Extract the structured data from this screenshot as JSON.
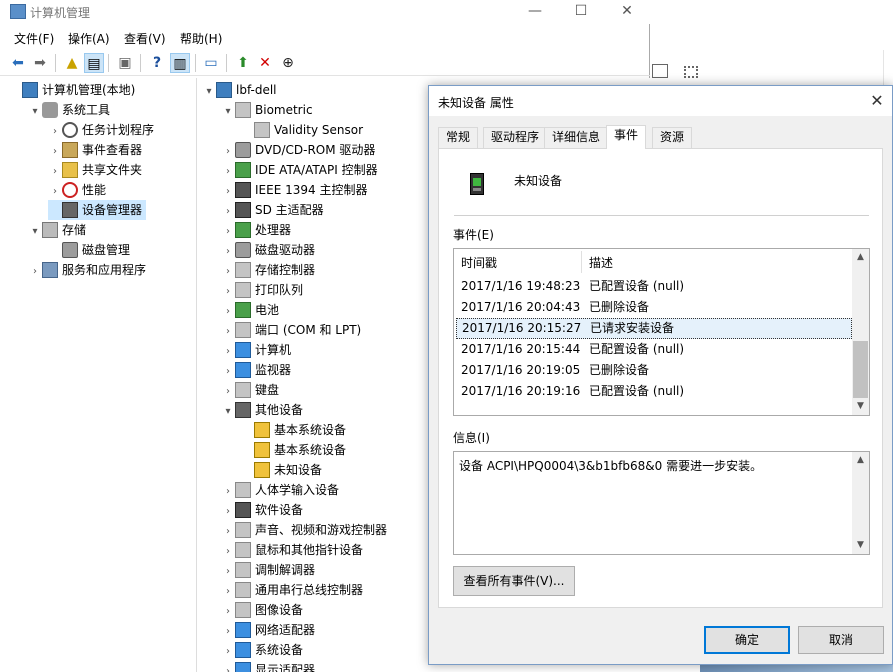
{
  "window": {
    "title": "计算机管理"
  },
  "menu": [
    "文件(F)",
    "操作(A)",
    "查看(V)",
    "帮助(H)"
  ],
  "left_tree": [
    {
      "label": "计算机管理(本地)",
      "indent": 0,
      "arrow": "",
      "icon": "i-pc"
    },
    {
      "label": "系统工具",
      "indent": 1,
      "arrow": "▾",
      "icon": "i-tool"
    },
    {
      "label": "任务计划程序",
      "indent": 2,
      "arrow": "›",
      "icon": "i-clock"
    },
    {
      "label": "事件查看器",
      "indent": 2,
      "arrow": "›",
      "icon": "i-ev"
    },
    {
      "label": "共享文件夹",
      "indent": 2,
      "arrow": "›",
      "icon": "i-share"
    },
    {
      "label": "性能",
      "indent": 2,
      "arrow": "›",
      "icon": "i-perf"
    },
    {
      "label": "设备管理器",
      "indent": 2,
      "arrow": "",
      "icon": "i-dev",
      "selected": true
    },
    {
      "label": "存储",
      "indent": 1,
      "arrow": "▾",
      "icon": "i-store"
    },
    {
      "label": "磁盘管理",
      "indent": 2,
      "arrow": "",
      "icon": "i-disk"
    },
    {
      "label": "服务和应用程序",
      "indent": 1,
      "arrow": "›",
      "icon": "i-svc"
    }
  ],
  "device_tree": [
    {
      "label": "lbf-dell",
      "indent": 0,
      "arrow": "▾",
      "icon": "i-pc"
    },
    {
      "label": "Biometric",
      "indent": 1,
      "arrow": "▾",
      "icon": "i-gray"
    },
    {
      "label": "Validity Sensor",
      "indent": 2,
      "arrow": "",
      "icon": "i-gray"
    },
    {
      "label": "DVD/CD-ROM 驱动器",
      "indent": 1,
      "arrow": "›",
      "icon": "i-disk"
    },
    {
      "label": "IDE ATA/ATAPI 控制器",
      "indent": 1,
      "arrow": "›",
      "icon": "i-green"
    },
    {
      "label": "IEEE 1394 主控制器",
      "indent": 1,
      "arrow": "›",
      "icon": "i-blk"
    },
    {
      "label": "SD 主适配器",
      "indent": 1,
      "arrow": "›",
      "icon": "i-blk"
    },
    {
      "label": "处理器",
      "indent": 1,
      "arrow": "›",
      "icon": "i-green"
    },
    {
      "label": "磁盘驱动器",
      "indent": 1,
      "arrow": "›",
      "icon": "i-disk"
    },
    {
      "label": "存储控制器",
      "indent": 1,
      "arrow": "›",
      "icon": "i-gray"
    },
    {
      "label": "打印队列",
      "indent": 1,
      "arrow": "›",
      "icon": "i-gray"
    },
    {
      "label": "电池",
      "indent": 1,
      "arrow": "›",
      "icon": "i-green"
    },
    {
      "label": "端口 (COM 和 LPT)",
      "indent": 1,
      "arrow": "›",
      "icon": "i-gray"
    },
    {
      "label": "计算机",
      "indent": 1,
      "arrow": "›",
      "icon": "i-mon"
    },
    {
      "label": "监视器",
      "indent": 1,
      "arrow": "›",
      "icon": "i-mon"
    },
    {
      "label": "键盘",
      "indent": 1,
      "arrow": "›",
      "icon": "i-gray"
    },
    {
      "label": "其他设备",
      "indent": 1,
      "arrow": "▾",
      "icon": "i-dev"
    },
    {
      "label": "基本系统设备",
      "indent": 2,
      "arrow": "",
      "icon": "i-warn"
    },
    {
      "label": "基本系统设备",
      "indent": 2,
      "arrow": "",
      "icon": "i-warn"
    },
    {
      "label": "未知设备",
      "indent": 2,
      "arrow": "",
      "icon": "i-warn"
    },
    {
      "label": "人体学输入设备",
      "indent": 1,
      "arrow": "›",
      "icon": "i-gray"
    },
    {
      "label": "软件设备",
      "indent": 1,
      "arrow": "›",
      "icon": "i-blk"
    },
    {
      "label": "声音、视频和游戏控制器",
      "indent": 1,
      "arrow": "›",
      "icon": "i-gray"
    },
    {
      "label": "鼠标和其他指针设备",
      "indent": 1,
      "arrow": "›",
      "icon": "i-gray"
    },
    {
      "label": "调制解调器",
      "indent": 1,
      "arrow": "›",
      "icon": "i-gray"
    },
    {
      "label": "通用串行总线控制器",
      "indent": 1,
      "arrow": "›",
      "icon": "i-gray"
    },
    {
      "label": "图像设备",
      "indent": 1,
      "arrow": "›",
      "icon": "i-gray"
    },
    {
      "label": "网络适配器",
      "indent": 1,
      "arrow": "›",
      "icon": "i-mon"
    },
    {
      "label": "系统设备",
      "indent": 1,
      "arrow": "›",
      "icon": "i-mon"
    },
    {
      "label": "显示适配器",
      "indent": 1,
      "arrow": "›",
      "icon": "i-mon"
    }
  ],
  "dialog": {
    "title": "未知设备 属性",
    "tabs": [
      "常规",
      "驱动程序",
      "详细信息",
      "事件",
      "资源"
    ],
    "active_tab": "事件",
    "device_name": "未知设备",
    "events_label": "事件(E)",
    "col_time": "时间戳",
    "col_desc": "描述",
    "events": [
      {
        "time": "2017/1/16 19:48:23",
        "desc": "已配置设备 (null)"
      },
      {
        "time": "2017/1/16 20:04:43",
        "desc": "已删除设备"
      },
      {
        "time": "2017/1/16 20:15:27",
        "desc": "已请求安装设备",
        "selected": true
      },
      {
        "time": "2017/1/16 20:15:44",
        "desc": "已配置设备 (null)"
      },
      {
        "time": "2017/1/16 20:19:05",
        "desc": "已删除设备"
      },
      {
        "time": "2017/1/16 20:19:16",
        "desc": "已配置设备 (null)"
      }
    ],
    "info_label": "信息(I)",
    "info_text": "设备 ACPI\\HPQ0004\\3&b1bfb68&0 需要进一步安装。",
    "view_all_label": "查看所有事件(V)...",
    "ok_label": "确定",
    "cancel_label": "取消"
  },
  "colors": {
    "selection": "#cce8ff",
    "accent": "#0078d7"
  }
}
